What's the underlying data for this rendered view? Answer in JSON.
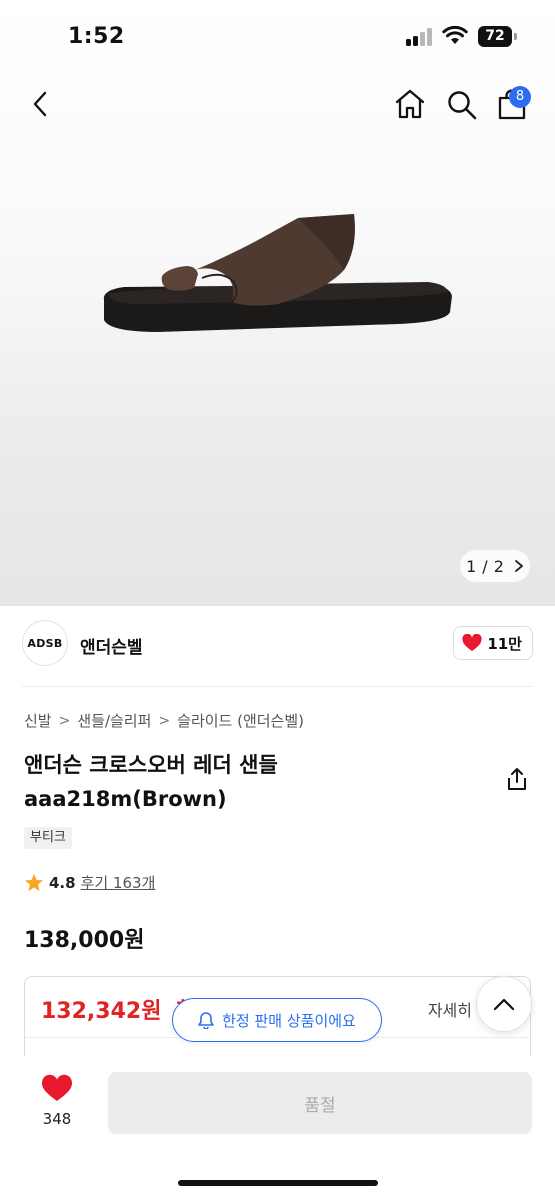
{
  "status_bar": {
    "time": "1:52",
    "battery": "72"
  },
  "nav": {
    "cart_count": "8",
    "icons": [
      "back-arrow-icon",
      "home-icon",
      "search-icon",
      "shopping-bag-icon"
    ]
  },
  "gallery": {
    "current": "1",
    "total": "2",
    "separator": "/"
  },
  "brand": {
    "logo_text": "ADSB",
    "name": "앤더슨벨",
    "likes": "11만"
  },
  "breadcrumb": [
    "신발",
    "샌들/슬리퍼",
    "슬라이드 (앤더슨벨)"
  ],
  "product": {
    "title": "앤더슨 크로스오버 레더 샌들 aaa218m(Brown)",
    "tag": "부티크",
    "rating": "4.8",
    "reviews": "후기 163개",
    "price": "138,000원"
  },
  "coupon": {
    "price": "132,342원",
    "suffix": "최",
    "details_link": "자세히"
  },
  "toast": {
    "text": "한정 판매 상품이에요"
  },
  "bottom": {
    "wish_count": "348",
    "purchase_label": "품절"
  },
  "colors": {
    "accent": "#2b6ef0",
    "sale_red": "#e02424",
    "heart_red": "#e8192c",
    "star": "#f5a623"
  }
}
